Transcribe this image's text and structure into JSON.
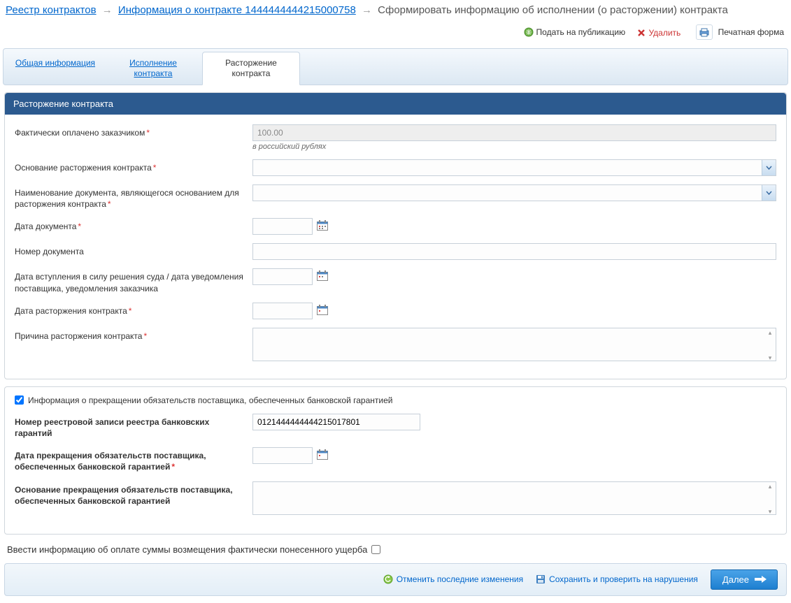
{
  "breadcrumb": {
    "link1": "Реестр контрактов",
    "link2": "Информация о контракте 1444444444215000758",
    "current": "Сформировать информацию об исполнении (о расторжении) контракта"
  },
  "toolbar": {
    "publish": "Подать на публикацию",
    "delete": "Удалить",
    "print": "Печатная форма"
  },
  "tabs": {
    "t1": "Общая информация",
    "t2": "Исполнение контракта",
    "t3": "Расторжение контракта"
  },
  "panel": {
    "title": "Расторжение контракта",
    "paid_label": "Фактически оплачено заказчиком",
    "paid_value": "100.00",
    "paid_hint": "в российский рублях",
    "basis_label": "Основание расторжения контракта",
    "docname_label": "Наименование документа, являющегося основанием для расторжения контракта",
    "docdate_label": "Дата документа",
    "docnum_label": "Номер документа",
    "courtdate_label": "Дата вступления в силу решения суда / дата уведомления поставщика, уведомления заказчика",
    "termdate_label": "Дата расторжения контракта",
    "reason_label": "Причина расторжения контракта"
  },
  "sub": {
    "checkbox_label": "Информация о прекращении обязательств поставщика, обеспеченных банковской гарантией",
    "regnum_label": "Номер реестровой записи реестра банковских гарантий",
    "regnum_value": "0121444444444215017801",
    "stopdate_label": "Дата прекращения обязательств поставщика, обеспеченных банковской гарантией",
    "stopbasis_label": "Основание прекращения обязательств поставщика, обеспеченных банковской гарантией"
  },
  "bottom_checkbox_label": "Ввести информацию об оплате суммы возмещения фактически понесенного ущерба",
  "footer": {
    "cancel": "Отменить последние изменения",
    "save": "Сохранить и проверить на нарушения",
    "next": "Далее"
  }
}
